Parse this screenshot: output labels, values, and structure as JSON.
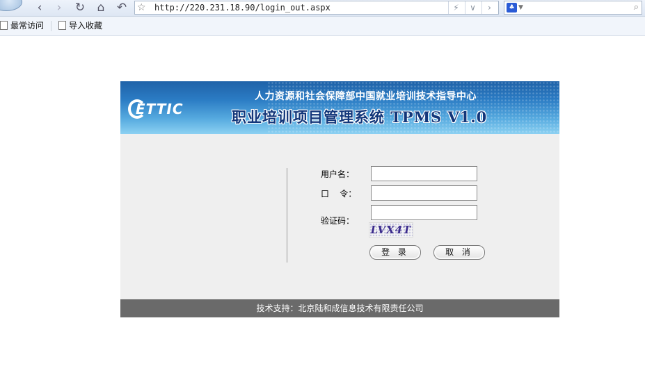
{
  "browser": {
    "url": "http://220.231.18.90/login_out.aspx",
    "bookmarks": [
      {
        "label": "最常访问"
      },
      {
        "label": "导入收藏"
      }
    ]
  },
  "banner": {
    "logo_text": "ETTIC",
    "organization": "人力资源和社会保障部中国就业培训技术指导中心",
    "system_title": "职业培训项目管理系统  TPMS  V1.0"
  },
  "form": {
    "username_label": "用户名：",
    "password_label": "口    令：",
    "captcha_label": "验证码：",
    "username_value": "",
    "password_value": "",
    "captcha_value": "",
    "captcha_text": "LVX4T",
    "login_button": "登 录",
    "cancel_button": "取 消"
  },
  "footer": {
    "text": "技术支持：北京陆和成信息技术有限责任公司"
  }
}
